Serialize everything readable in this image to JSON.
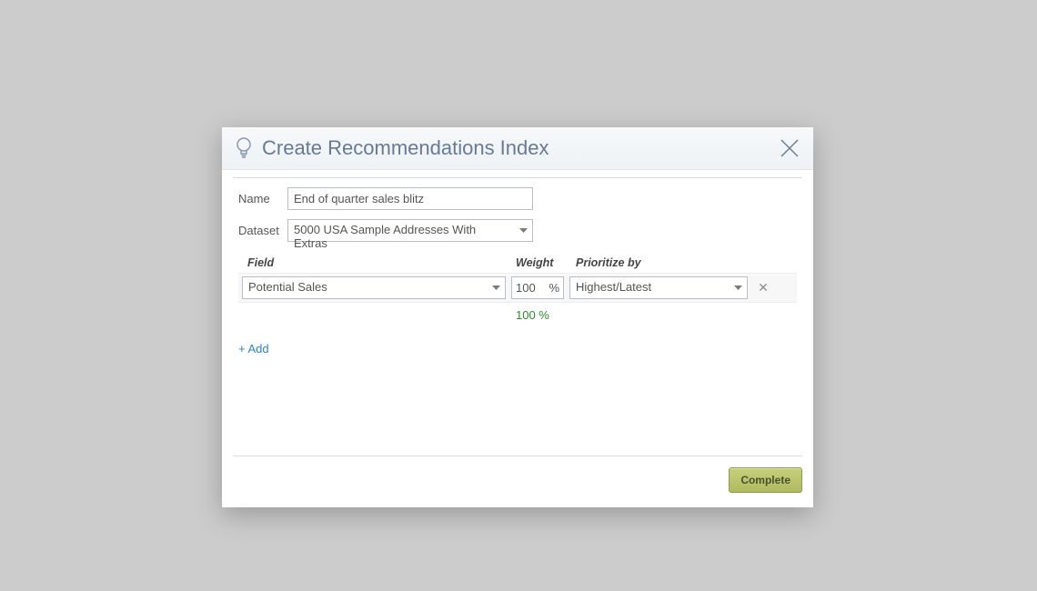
{
  "dialog": {
    "title": "Create Recommendations Index",
    "form": {
      "name_label": "Name",
      "name_value": "End of quarter sales blitz",
      "dataset_label": "Dataset",
      "dataset_value": "5000 USA Sample Addresses With Extras"
    },
    "columns": {
      "field": "Field",
      "weight": "Weight",
      "prioritize_by": "Prioritize by"
    },
    "rows": [
      {
        "field": "Potential Sales",
        "weight_value": "100",
        "weight_unit": "%",
        "prioritize_by": "Highest/Latest"
      }
    ],
    "total": "100 %",
    "add_link": "+ Add",
    "complete_button": "Complete"
  }
}
